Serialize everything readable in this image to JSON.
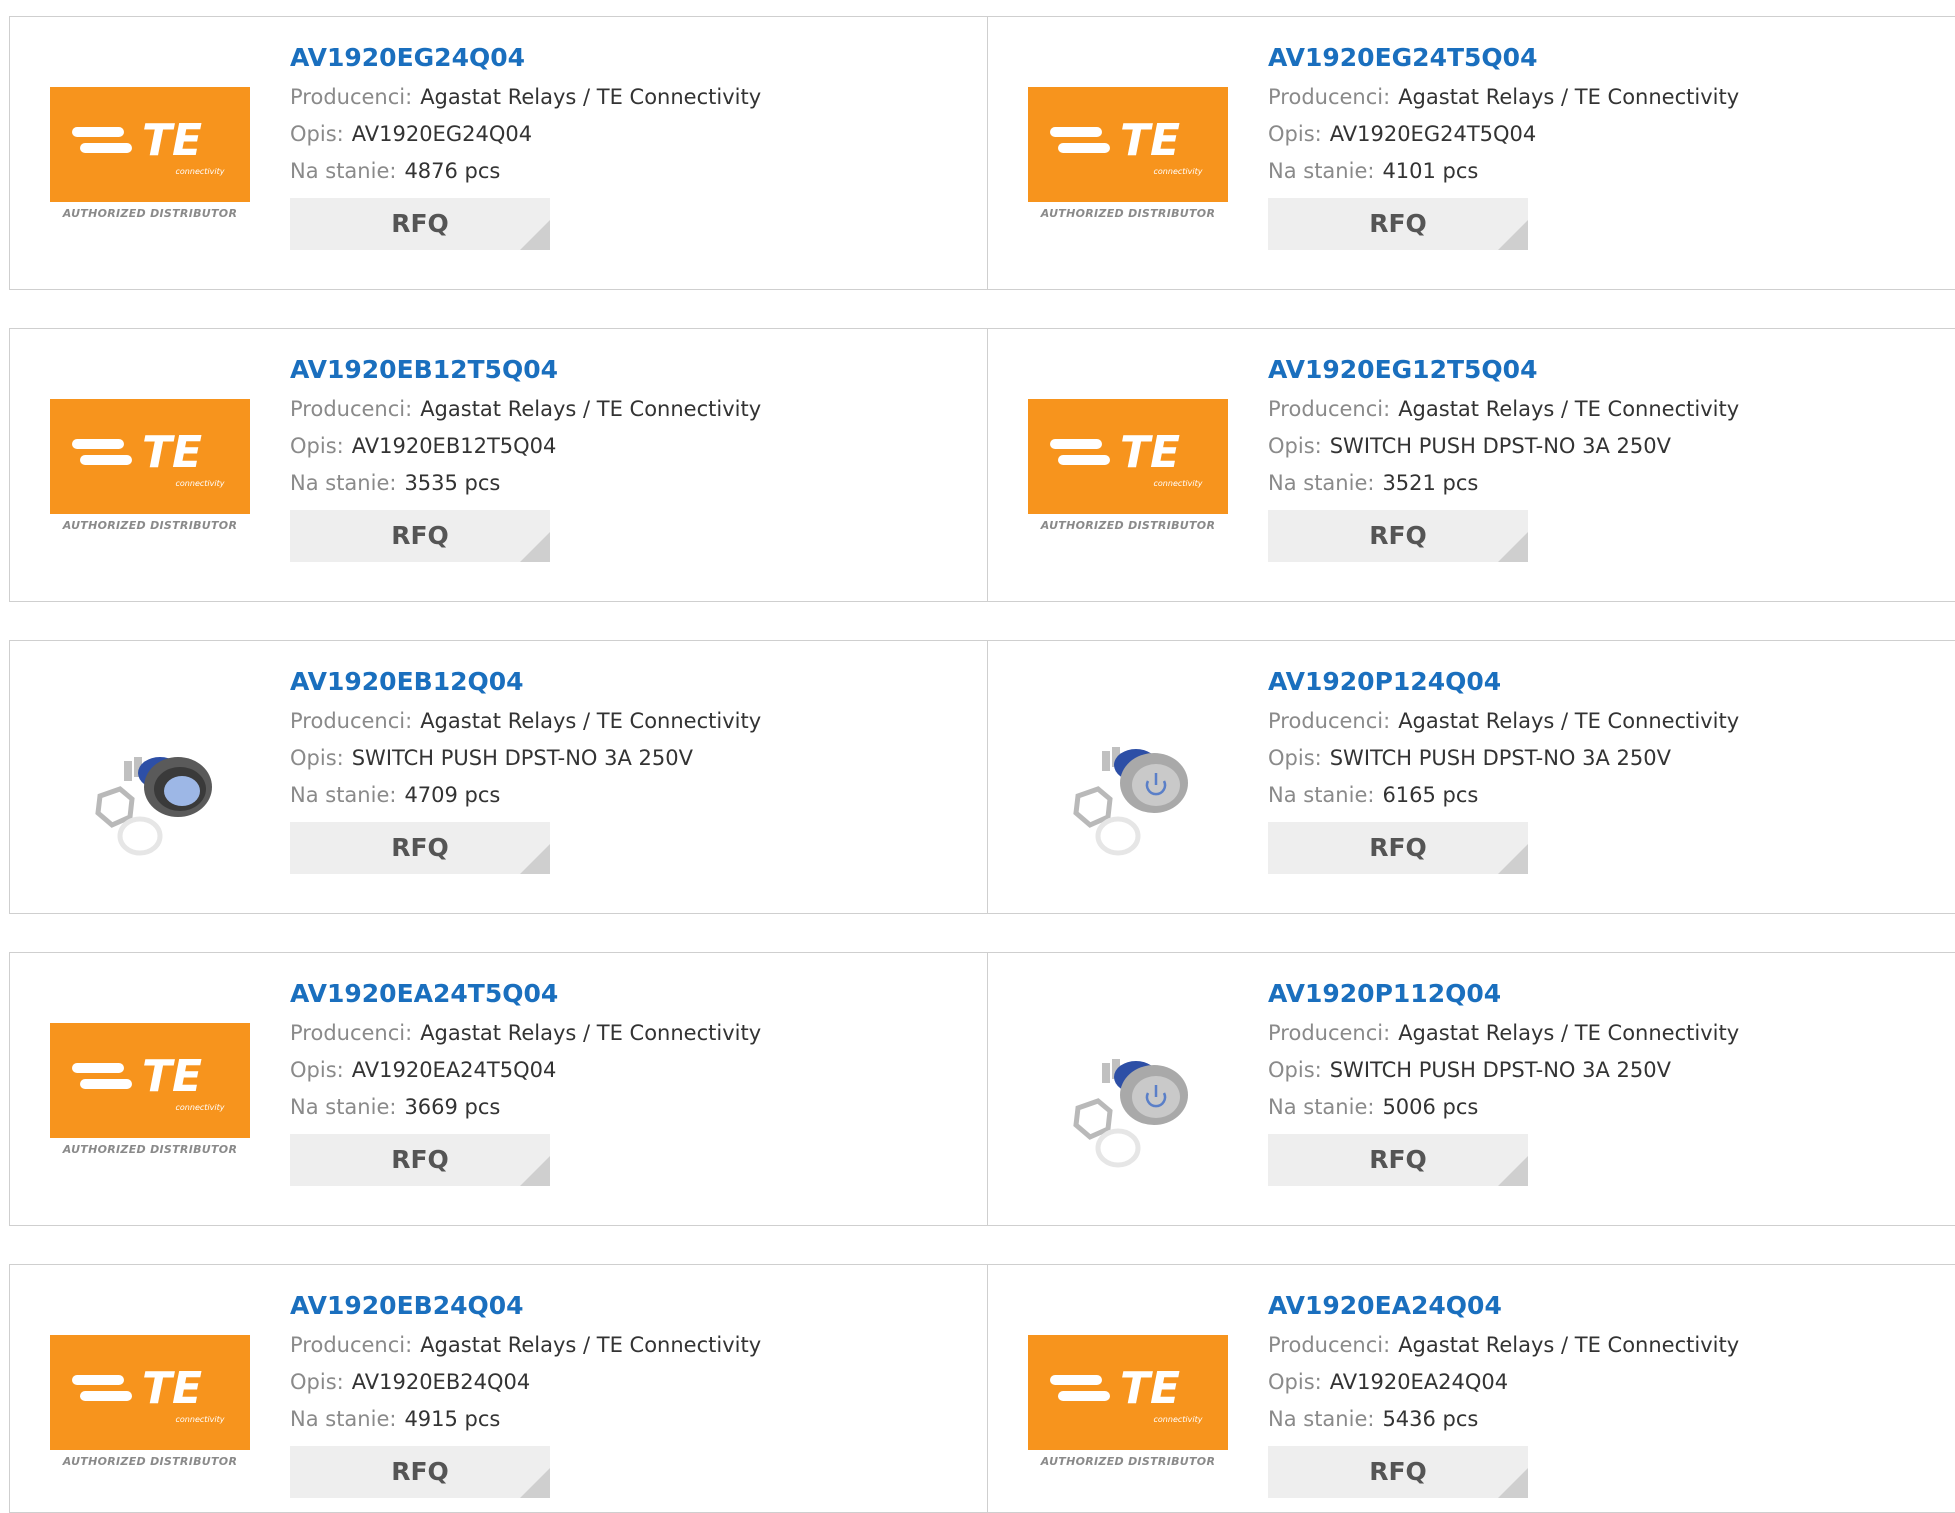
{
  "labels": {
    "manufacturer": "Producenci:",
    "description": "Opis:",
    "stock": "Na stanie:",
    "rfq": "RFQ"
  },
  "logo": {
    "brand": "TE",
    "sub": "connectivity",
    "tagline": "AUTHORIZED DISTRIBUTOR",
    "color": "#f7941d"
  },
  "colors": {
    "title_link": "#1a6fbe",
    "label": "#8a8a8a",
    "value": "#333333",
    "rfq_bg": "#eeeeee"
  },
  "products": [
    {
      "part": "AV1920EG24Q04",
      "manufacturer": "Agastat Relays / TE Connectivity",
      "description": "AV1920EG24Q04",
      "stock": "4876 pcs",
      "image": "te-logo"
    },
    {
      "part": "AV1920EG24T5Q04",
      "manufacturer": "Agastat Relays / TE Connectivity",
      "description": "AV1920EG24T5Q04",
      "stock": "4101 pcs",
      "image": "te-logo"
    },
    {
      "part": "AV1920EB12T5Q04",
      "manufacturer": "Agastat Relays / TE Connectivity",
      "description": "AV1920EB12T5Q04",
      "stock": "3535 pcs",
      "image": "te-logo"
    },
    {
      "part": "AV1920EG12T5Q04",
      "manufacturer": "Agastat Relays / TE Connectivity",
      "description": "SWITCH PUSH DPST-NO 3A 250V",
      "stock": "3521 pcs",
      "image": "te-logo"
    },
    {
      "part": "AV1920EB12Q04",
      "manufacturer": "Agastat Relays / TE Connectivity",
      "description": "SWITCH PUSH DPST-NO 3A 250V",
      "stock": "4709 pcs",
      "image": "switch-photo-dark"
    },
    {
      "part": "AV1920P124Q04",
      "manufacturer": "Agastat Relays / TE Connectivity",
      "description": "SWITCH PUSH DPST-NO 3A 250V",
      "stock": "6165 pcs",
      "image": "switch-photo-power"
    },
    {
      "part": "AV1920EA24T5Q04",
      "manufacturer": "Agastat Relays / TE Connectivity",
      "description": "AV1920EA24T5Q04",
      "stock": "3669 pcs",
      "image": "te-logo"
    },
    {
      "part": "AV1920P112Q04",
      "manufacturer": "Agastat Relays / TE Connectivity",
      "description": "SWITCH PUSH DPST-NO 3A 250V",
      "stock": "5006 pcs",
      "image": "switch-photo-power"
    },
    {
      "part": "AV1920EB24Q04",
      "manufacturer": "Agastat Relays / TE Connectivity",
      "description": "AV1920EB24Q04",
      "stock": "4915 pcs",
      "image": "te-logo"
    },
    {
      "part": "AV1920EA24Q04",
      "manufacturer": "Agastat Relays / TE Connectivity",
      "description": "AV1920EA24Q04",
      "stock": "5436 pcs",
      "image": "te-logo"
    }
  ]
}
